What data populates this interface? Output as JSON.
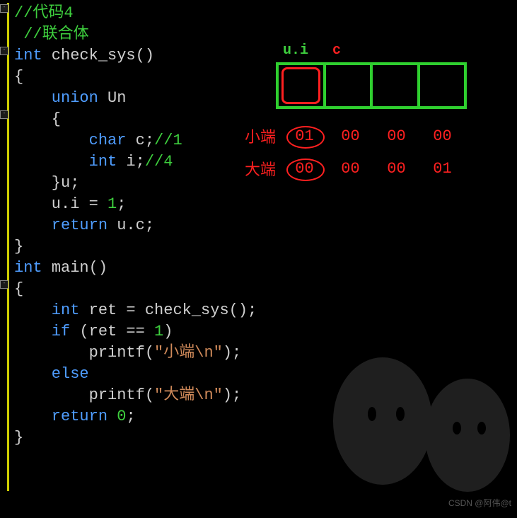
{
  "code": {
    "l01": "//代码4",
    "l02": " //联合体",
    "l03a": "int",
    "l03b": " check_sys()",
    "l04": "{",
    "l05": "",
    "l06a": "    union",
    "l06b": " Un",
    "l07": "    {",
    "l08a": "        char",
    "l08b": " c;",
    "l08c": "//1",
    "l09a": "        int",
    "l09b": " i;",
    "l09c": "//4",
    "l10": "    }u;",
    "l11a": "    u.i = ",
    "l11b": "1",
    "l11c": ";",
    "l12a": "    return",
    "l12b": " u.c;",
    "l13": "}",
    "l14a": "int",
    "l14b": " main()",
    "l15": "{",
    "l16a": "    int",
    "l16b": " ret = check_sys();",
    "l17a": "    if",
    "l17b": " (ret == ",
    "l17c": "1",
    "l17d": ")",
    "l18a": "        printf(",
    "l18b": "\"小端\\n\"",
    "l18c": ");",
    "l19a": "    else",
    "l20a": "        printf(",
    "l20b": "\"大端\\n\"",
    "l20c": ");",
    "l21a": "    return ",
    "l21b": "0",
    "l21c": ";",
    "l22": "}"
  },
  "diagram": {
    "label_ui": "u.i",
    "label_c": "c",
    "little_endian_label": "小端",
    "big_endian_label": "大端",
    "le_bytes": [
      "01",
      "00",
      "00",
      "00"
    ],
    "be_bytes": [
      "00",
      "00",
      "00",
      "01"
    ]
  },
  "watermark": "CSDN @阿伟@t"
}
